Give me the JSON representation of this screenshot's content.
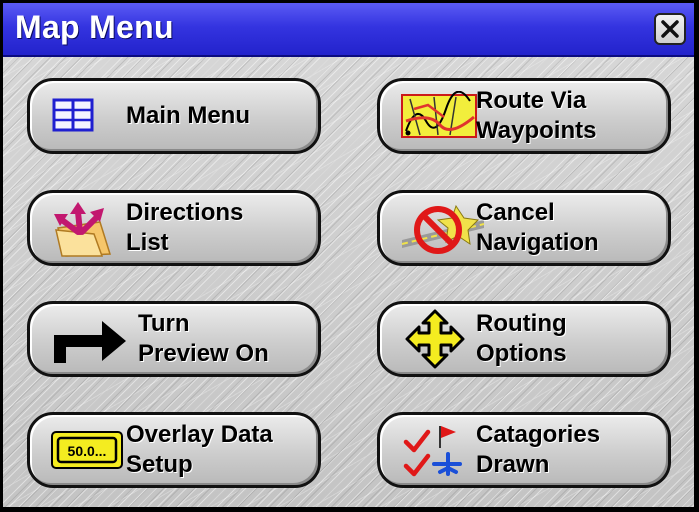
{
  "window": {
    "title": "Map Menu",
    "close_icon": "close-icon"
  },
  "buttons": [
    {
      "label_line1": "Main Menu",
      "label_line2": "",
      "icon": "main-menu-icon"
    },
    {
      "label_line1": "Route Via",
      "label_line2": "Waypoints",
      "icon": "route-waypoints-icon"
    },
    {
      "label_line1": "Directions",
      "label_line2": "List",
      "icon": "directions-list-icon"
    },
    {
      "label_line1": "Cancel",
      "label_line2": "Navigation",
      "icon": "cancel-navigation-icon"
    },
    {
      "label_line1": "Turn",
      "label_line2": "Preview On",
      "icon": "turn-arrow-icon"
    },
    {
      "label_line1": "Routing",
      "label_line2": "Options",
      "icon": "routing-options-icon"
    },
    {
      "label_line1": "Overlay Data",
      "label_line2": "Setup",
      "icon": "overlay-data-icon",
      "icon_text": "50.0..."
    },
    {
      "label_line1": "Catagories",
      "label_line2": "Drawn",
      "icon": "categories-drawn-icon"
    }
  ]
}
